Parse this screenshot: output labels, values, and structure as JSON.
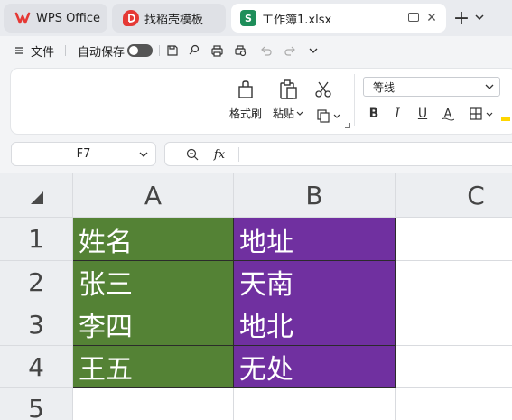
{
  "tabs": [
    {
      "label": "WPS Office",
      "icon": "wps-logo-icon",
      "color": "#e53935"
    },
    {
      "label": "找稻壳模板",
      "icon": "docer-logo-icon",
      "color": "#e53935"
    },
    {
      "label": "工作簿1.xlsx",
      "icon": "spreadsheet-logo-icon",
      "color": "#1e8e5a",
      "active": true
    }
  ],
  "menu": {
    "file_label": "文件",
    "autosave_label": "自动保存"
  },
  "ribbon": {
    "format_painter_label": "格式刷",
    "paste_label": "粘贴",
    "font_name": "等线",
    "bold": "B",
    "italic": "I",
    "underline": "U",
    "strike": "A"
  },
  "formula_bar": {
    "name_box": "F7",
    "formula": ""
  },
  "sheet": {
    "columns": [
      "A",
      "B",
      "C"
    ],
    "rows": [
      "1",
      "2",
      "3",
      "4",
      "5"
    ],
    "cells": [
      [
        "姓名",
        "地址"
      ],
      [
        "张三",
        "天南"
      ],
      [
        "李四",
        "地北"
      ],
      [
        "王五",
        "无处"
      ]
    ],
    "colors": {
      "column_a_fill": "#548235",
      "column_b_fill": "#7030a0",
      "cell_text": "#ffffff"
    }
  }
}
